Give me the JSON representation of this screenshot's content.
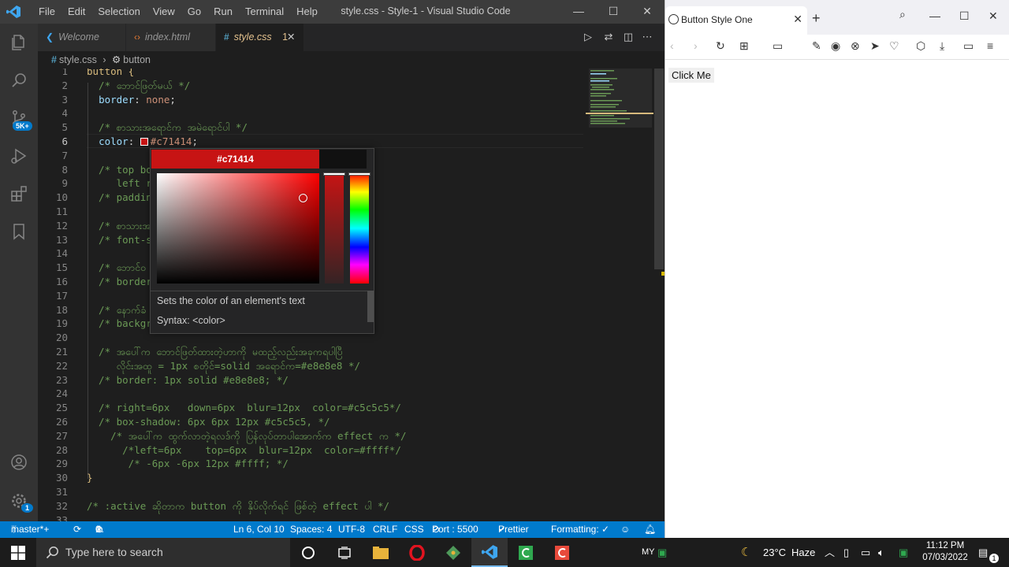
{
  "vscode": {
    "menus": [
      "File",
      "Edit",
      "Selection",
      "View",
      "Go",
      "Run",
      "Terminal",
      "Help"
    ],
    "window_title": "style.css - Style-1 - Visual Studio Code",
    "activity_badges": {
      "source_control": "5K+",
      "accounts_settings": "1"
    },
    "tabs": [
      {
        "label": "Welcome",
        "active": false
      },
      {
        "label": "index.html",
        "active": false
      },
      {
        "label": "style.css",
        "active": true,
        "problems": "1"
      }
    ],
    "breadcrumb": {
      "file": "style.css",
      "symbol": "button"
    },
    "code_lines": [
      {
        "n": "1",
        "text": "button {"
      },
      {
        "n": "2",
        "text": "  /* ဘောင်ဖြတ်မယ် */"
      },
      {
        "n": "3",
        "text": "  border: none;"
      },
      {
        "n": "4",
        "text": ""
      },
      {
        "n": "5",
        "text": "  /* စာသားအရောင်က အမဲရောင်ပါ */"
      },
      {
        "n": "6",
        "text": "  color: #c71414;"
      },
      {
        "n": "7",
        "text": ""
      },
      {
        "n": "8",
        "text": "  /* top bo"
      },
      {
        "n": "9",
        "text": "     left ri"
      },
      {
        "n": "10",
        "text": "  /* paddin"
      },
      {
        "n": "11",
        "text": ""
      },
      {
        "n": "12",
        "text": "  /* စာသားအ"
      },
      {
        "n": "13",
        "text": "  /* font-s"
      },
      {
        "n": "14",
        "text": ""
      },
      {
        "n": "15",
        "text": "  /* ဘောင်ဝ"
      },
      {
        "n": "16",
        "text": "  /* border"
      },
      {
        "n": "17",
        "text": ""
      },
      {
        "n": "18",
        "text": "  /* နောက်ခံ"
      },
      {
        "n": "19",
        "text": "  /* backgr"
      },
      {
        "n": "20",
        "text": ""
      },
      {
        "n": "21",
        "text": "  /* အပေါ်က ဘောင်ဖြတ်ထားတဲ့ဟာကို မထည့်လည်းအခုကရပါပြီ"
      },
      {
        "n": "22",
        "text": "     လိုင်းအထူ = 1px စတိုင်=solid အရောင်က=#e8e8e8 */"
      },
      {
        "n": "23",
        "text": "  /* border: 1px solid #e8e8e8; */"
      },
      {
        "n": "24",
        "text": ""
      },
      {
        "n": "25",
        "text": "  /* right=6px   down=6px  blur=12px  color=#c5c5c5*/"
      },
      {
        "n": "26",
        "text": "  /* box-shadow: 6px 6px 12px #c5c5c5, */"
      },
      {
        "n": "27",
        "text": "    /* အပေါ်က ထွက်လာတဲ့ရလဒ်ကို ပြန်လုပ်တာပါအောက်က effect က */"
      },
      {
        "n": "28",
        "text": "      /*left=6px    top=6px  blur=12px  color=#ffff*/"
      },
      {
        "n": "29",
        "text": "       /* -6px -6px 12px #ffff; */"
      },
      {
        "n": "30",
        "text": "}"
      },
      {
        "n": "31",
        "text": ""
      },
      {
        "n": "32",
        "text": "/* :active ဆိုတာက button ကို နှိပ်လိုက်ရင် ဖြစ်တဲ့ effect ပါ */"
      },
      {
        "n": "33",
        "text": ""
      }
    ],
    "color_picker": {
      "color": "#c71414",
      "description": "Sets the color of an element's text",
      "syntax": "Syntax: <color>"
    },
    "status": {
      "branch": "master*+",
      "problems_errors": "0",
      "problems_warnings": "1",
      "position": "Ln 6, Col 10",
      "spaces": "Spaces: 4",
      "encoding": "UTF-8",
      "eol": "CRLF",
      "language": "CSS",
      "port": "Port : 5500",
      "prettier": "Prettier",
      "formatting": "Formatting: ✓"
    }
  },
  "browser": {
    "tab_title": "Button Style One",
    "button_label": "Click Me"
  },
  "taskbar": {
    "search_placeholder": "Type here to search",
    "lang": "MY",
    "weather_temp": "23°C",
    "weather_desc": "Haze",
    "time": "11:12 PM",
    "date": "07/03/2022",
    "notifications": "1"
  },
  "colors": {
    "accent": "#007acc",
    "picked": "#c71414"
  }
}
